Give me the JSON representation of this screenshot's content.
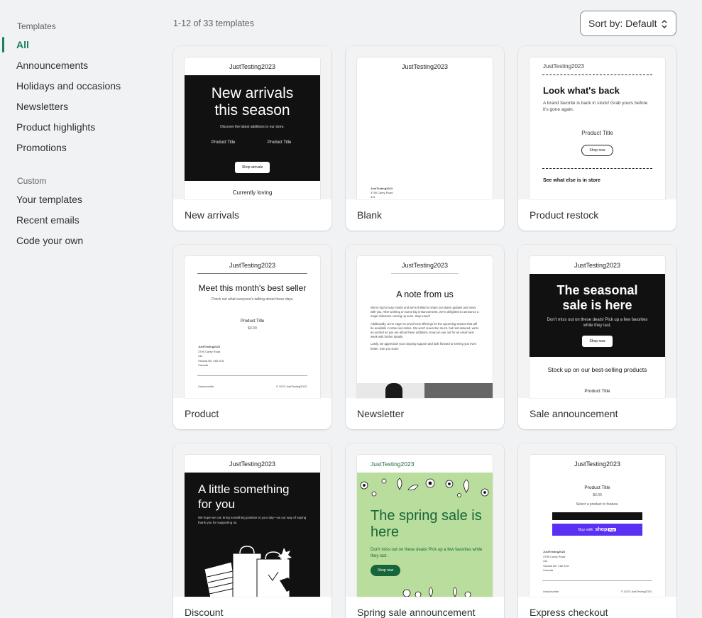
{
  "sidebar": {
    "heading_templates": "Templates",
    "items": [
      {
        "label": "All",
        "active": true
      },
      {
        "label": "Announcements"
      },
      {
        "label": "Holidays and occasions"
      },
      {
        "label": "Newsletters"
      },
      {
        "label": "Product highlights"
      },
      {
        "label": "Promotions"
      }
    ],
    "heading_custom": "Custom",
    "custom_items": [
      {
        "label": "Your templates"
      },
      {
        "label": "Recent emails"
      },
      {
        "label": "Code your own"
      }
    ]
  },
  "header": {
    "count": "1-12 of 33 templates",
    "sort_label": "Sort by: Default"
  },
  "colors": {
    "accent": "#1a7f5a",
    "spring_green": "#b9dd9c",
    "shop_purple": "#5a31f4"
  },
  "cards": {
    "new_arrivals": {
      "name": "New arrivals",
      "store": "JustTesting2023",
      "headline": "New arrivals this season",
      "sub": "Discover the latest additions to our store.",
      "product1": "Product Title",
      "product2": "Product Title",
      "button": "Shop arrivals",
      "footer": "Currently loving"
    },
    "blank": {
      "name": "Blank",
      "store": "JustTesting2023",
      "addr1": "JustTesting2023",
      "addr2": "3795 Carey Road",
      "addr3": "411"
    },
    "product_restock": {
      "name": "Product restock",
      "store": "JustTesting2023",
      "headline": "Look what's back",
      "sub": "A brand favorite is back in stock! Grab yours before it's gone again.",
      "product": "Product Title",
      "button": "Shop now",
      "more": "See what else is in store"
    },
    "product": {
      "name": "Product",
      "store": "JustTesting2023",
      "headline": "Meet this month's best seller",
      "sub": "Check out what everyone's talking about these days.",
      "product": "Product Title",
      "price": "$0.00",
      "addr1": "JustTesting2023",
      "addr2": "3795 Carey Road",
      "addr3": "411",
      "addr4": "Victoria BC V8Z 6T8",
      "addr5": "Canada",
      "unsub": "Unsubscribe",
      "copy": "© 2023 JustTesting2023"
    },
    "newsletter": {
      "name": "Newsletter",
      "store": "JustTesting2023",
      "headline": "A note from us",
      "p1": "We've had a busy month and we're thrilled to share our latest updates and news with you. After working on some big enhancements, we're delighted to announce a major milestone coming up soon. Stay tuned!",
      "p2": "Additionally, we're eager to unveil new offerings for the upcoming season that will be available in store and online. We won't reveal too much, but rest assured, we're as excited as you are about these additions. Keep an eye out for an email next week with further details.",
      "p3": "Lastly, we appreciate your ongoing support and look forward to serving you even better. See you soon!"
    },
    "sale_announcement": {
      "name": "Sale announcement",
      "store": "JustTesting2023",
      "headline": "The seasonal sale is here",
      "sub": "Don't miss out on these deals! Pick up a few favorites while they last.",
      "button": "Shop now",
      "section": "Stock up on our best-selling products",
      "product": "Product Title"
    },
    "discount": {
      "name": "Discount",
      "store": "JustTesting2023",
      "headline": "A little something for you",
      "sub": "We hope we can bring something positive to your day—as our way of saying thank you for supporting us."
    },
    "spring_sale": {
      "name": "Spring sale announcement",
      "store": "JustTesting2023",
      "headline": "The spring sale is here",
      "sub": "Don't miss out on these deals! Pick up a few favorites while they last.",
      "button": "Shop now"
    },
    "express_checkout": {
      "name": "Express checkout",
      "store": "JustTesting2023",
      "product": "Product Title",
      "price": "$0.00",
      "select": "Select a product to feature.",
      "buy": "Buy with",
      "shop": "shop",
      "pay": "Pay",
      "addr1": "JustTesting2023",
      "addr2": "3795 Carey Road",
      "addr3": "411",
      "addr4": "Victoria BC V8Z 6T8",
      "addr5": "Canada",
      "unsub": "Unsubscribe",
      "copy": "© 2023 JustTesting2023"
    }
  }
}
